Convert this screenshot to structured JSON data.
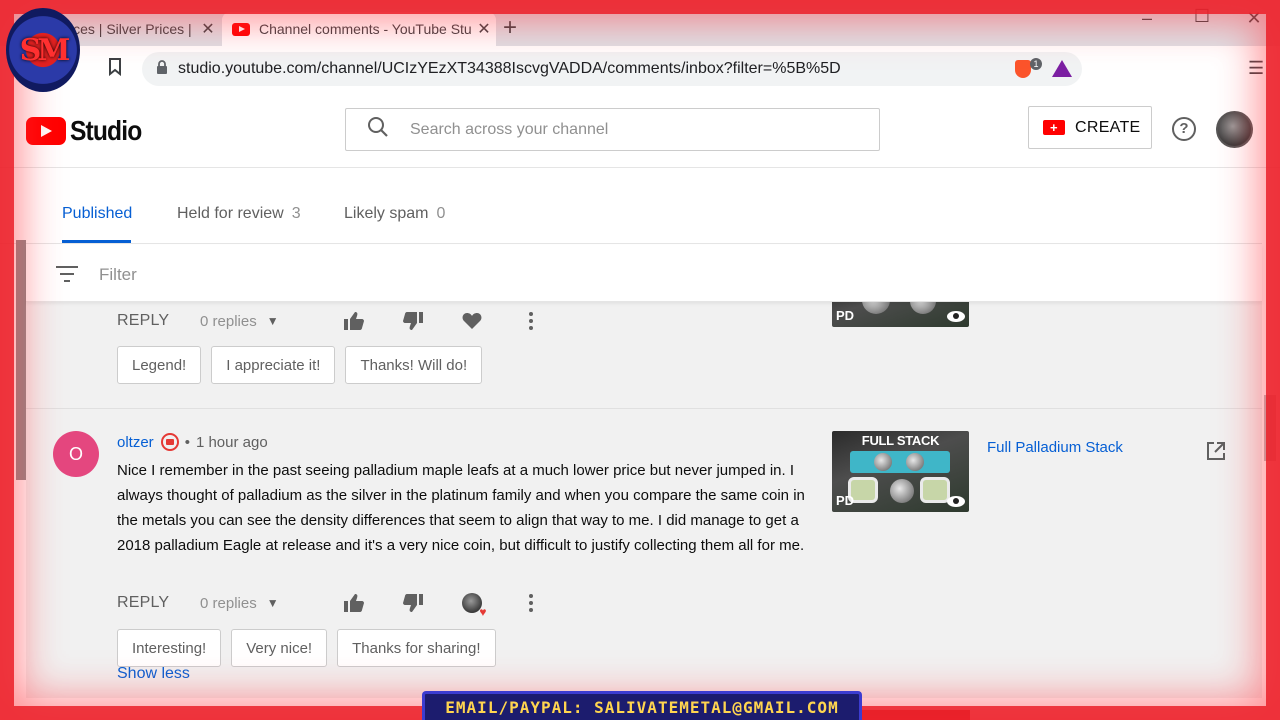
{
  "browser": {
    "tabs": [
      {
        "label": "Prices | Silver Prices | Pla",
        "active": false
      },
      {
        "label": "Channel comments - YouTube Stu",
        "active": true
      }
    ],
    "url": "studio.youtube.com/channel/UCIzYEzXT34388IscvgVADDA/comments/inbox?filter=%5B%5D",
    "extension_badge": "1"
  },
  "header": {
    "logo_text": "Studio",
    "search_placeholder": "Search across your channel",
    "create_label": "CREATE"
  },
  "tabs": [
    {
      "label": "Published",
      "count": "",
      "active": true
    },
    {
      "label": "Held for review",
      "count": "3",
      "active": false
    },
    {
      "label": "Likely spam",
      "count": "0",
      "active": false
    }
  ],
  "filter": {
    "label": "Filter"
  },
  "comments": [
    {
      "reply_label": "REPLY",
      "replies": "0 replies",
      "suggestions": [
        "Legend!",
        "I appreciate it!",
        "Thanks! Will do!"
      ],
      "thumb": {
        "badge": "PD"
      }
    },
    {
      "avatar_letter": "O",
      "author": "oltzer",
      "separator": "•",
      "time": "1 hour ago",
      "text": "Nice I remember in the past seeing palladium maple leafs at a much lower price but never jumped in. I always thought of palladium as the silver in the platinum family and when you compare the same coin in the metals you can see the density differences that seem to align that way to me. I did manage to get a 2018 palladium Eagle at release  and it's a very nice coin, but difficult to justify collecting them all for me.",
      "show_less": "Show less",
      "reply_label": "REPLY",
      "replies": "0 replies",
      "suggestions": [
        "Interesting!",
        "Very nice!",
        "Thanks for sharing!"
      ],
      "video_title": "Full Palladium Stack",
      "thumb": {
        "title": "FULL STACK",
        "badge": "PD"
      }
    }
  ],
  "overlay": {
    "logo": "SM",
    "banner": "EMAIL/PAYPAL: SALIVATEMETAL@GMAIL.COM"
  },
  "colors": {
    "accent": "#065fd4",
    "brand_red": "#ff0000",
    "overlay_red": "#eb1e28"
  }
}
